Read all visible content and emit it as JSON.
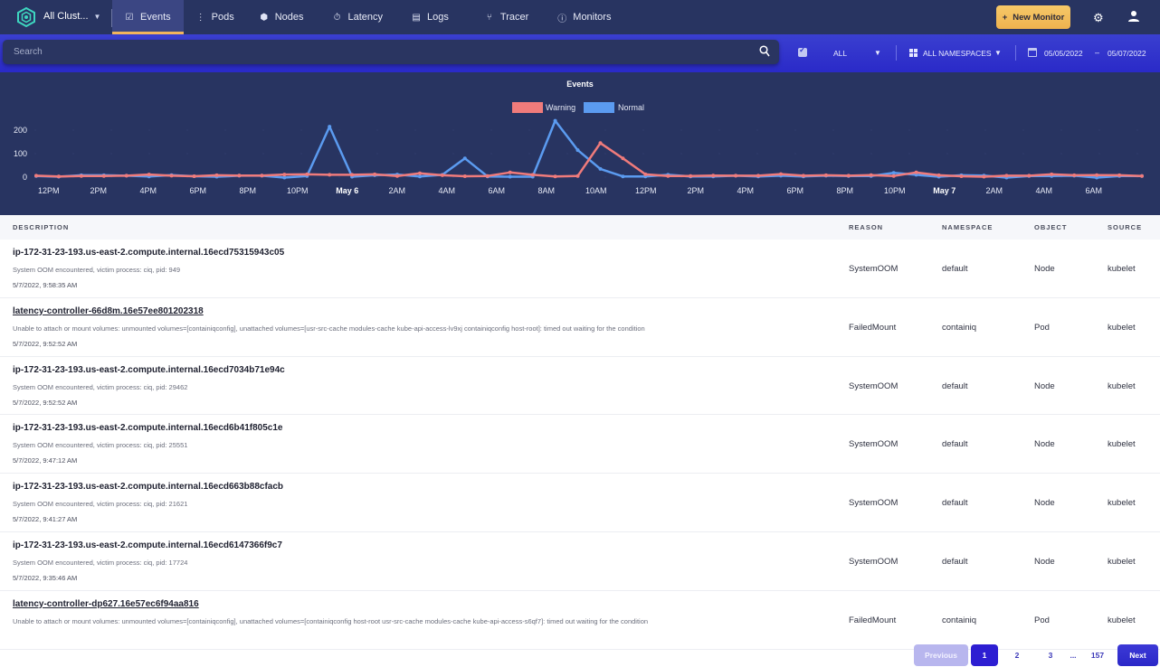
{
  "topbar": {
    "cluster_label": "All Clust...",
    "nav": [
      {
        "label": "Events",
        "icon": "check-square-icon",
        "active": true
      },
      {
        "label": "Pods",
        "icon": "dots-vertical-icon",
        "active": false
      },
      {
        "label": "Nodes",
        "icon": "hexagon-icon",
        "active": false
      },
      {
        "label": "Latency",
        "icon": "stopwatch-icon",
        "active": false
      },
      {
        "label": "Logs",
        "icon": "document-icon",
        "active": false
      },
      {
        "label": "Tracer",
        "icon": "branch-icon",
        "active": false
      },
      {
        "label": "Monitors",
        "icon": "info-circle-icon",
        "active": false
      }
    ],
    "new_monitor_label": "New Monitor",
    "new_monitor_plus": "+"
  },
  "filters": {
    "search_placeholder": "Search",
    "search_value": "",
    "type_value": "ALL",
    "namespace_value": "ALL NAMESPACES",
    "date_from": "05/05/2022",
    "date_sep": "–",
    "date_to": "05/07/2022"
  },
  "chart_data": {
    "type": "line",
    "title": "Events",
    "legend_position": "top-center",
    "xlabel": "",
    "ylabel": "",
    "ylim": [
      0,
      250
    ],
    "yticks": [
      "0",
      "100",
      "200"
    ],
    "x_tick_labels": [
      "12PM",
      "2PM",
      "4PM",
      "6PM",
      "8PM",
      "10PM",
      "May 6",
      "2AM",
      "4AM",
      "6AM",
      "8AM",
      "10AM",
      "12PM",
      "2PM",
      "4PM",
      "6PM",
      "8PM",
      "10PM",
      "May 7",
      "2AM",
      "4AM",
      "6AM"
    ],
    "x_tick_bold": [
      "May 6",
      "May 7"
    ],
    "x_start_hours": -0.5,
    "x_step_hours": 1,
    "series": [
      {
        "name": "Warning",
        "color": "#f07b7b",
        "values": [
          6,
          3,
          5,
          5,
          6,
          11,
          6,
          4,
          8,
          7,
          7,
          11,
          12,
          10,
          10,
          12,
          5,
          16,
          8,
          4,
          5,
          20,
          10,
          3,
          5,
          145,
          80,
          12,
          5,
          5,
          7,
          6,
          6,
          13,
          6,
          8,
          6,
          9,
          5,
          20,
          8,
          4,
          2,
          6,
          6,
          12,
          8,
          9,
          8,
          5
        ]
      },
      {
        "name": "Normal",
        "color": "#5b9bf0",
        "values": [
          5,
          2,
          8,
          8,
          6,
          3,
          9,
          4,
          2,
          6,
          6,
          -2,
          5,
          215,
          2,
          8,
          11,
          3,
          10,
          80,
          3,
          2,
          2,
          240,
          115,
          35,
          3,
          3,
          10,
          3,
          3,
          6,
          3,
          6,
          3,
          6,
          5,
          5,
          18,
          10,
          2,
          8,
          7,
          -2,
          5,
          5,
          6,
          -2,
          5,
          5
        ]
      }
    ]
  },
  "table": {
    "headers": {
      "description": "DESCRIPTION",
      "reason": "REASON",
      "namespace": "NAMESPACE",
      "object": "OBJECT",
      "source": "SOURCE"
    },
    "rows": [
      {
        "name": "ip-172-31-23-193.us-east-2.compute.internal.16ecd75315943c05",
        "link": false,
        "message": "System OOM encountered, victim process: ciq, pid: 949",
        "time": "5/7/2022, 9:58:35 AM",
        "reason": "SystemOOM",
        "namespace": "default",
        "object": "Node",
        "source": "kubelet"
      },
      {
        "name": "latency-controller-66d8m.16e57ee801202318",
        "link": true,
        "message": "Unable to attach or mount volumes: unmounted volumes=[containiqconfig], unattached volumes=[usr-src-cache modules-cache kube-api-access-lv9xj containiqconfig host-root]: timed out waiting for the condition",
        "time": "5/7/2022, 9:52:52 AM",
        "reason": "FailedMount",
        "namespace": "containiq",
        "object": "Pod",
        "source": "kubelet"
      },
      {
        "name": "ip-172-31-23-193.us-east-2.compute.internal.16ecd7034b71e94c",
        "link": false,
        "message": "System OOM encountered, victim process: ciq, pid: 29462",
        "time": "5/7/2022, 9:52:52 AM",
        "reason": "SystemOOM",
        "namespace": "default",
        "object": "Node",
        "source": "kubelet"
      },
      {
        "name": "ip-172-31-23-193.us-east-2.compute.internal.16ecd6b41f805c1e",
        "link": false,
        "message": "System OOM encountered, victim process: ciq, pid: 25551",
        "time": "5/7/2022, 9:47:12 AM",
        "reason": "SystemOOM",
        "namespace": "default",
        "object": "Node",
        "source": "kubelet"
      },
      {
        "name": "ip-172-31-23-193.us-east-2.compute.internal.16ecd663b88cfacb",
        "link": false,
        "message": "System OOM encountered, victim process: ciq, pid: 21621",
        "time": "5/7/2022, 9:41:27 AM",
        "reason": "SystemOOM",
        "namespace": "default",
        "object": "Node",
        "source": "kubelet"
      },
      {
        "name": "ip-172-31-23-193.us-east-2.compute.internal.16ecd6147366f9c7",
        "link": false,
        "message": "System OOM encountered, victim process: ciq, pid: 17724",
        "time": "5/7/2022, 9:35:46 AM",
        "reason": "SystemOOM",
        "namespace": "default",
        "object": "Node",
        "source": "kubelet"
      },
      {
        "name": "latency-controller-dp627.16e57ec6f94aa816",
        "link": true,
        "message": "Unable to attach or mount volumes: unmounted volumes=[containiqconfig], unattached volumes=[containiqconfig host-root usr-src-cache modules-cache kube-api-access-s6qf7]: timed out waiting for the condition",
        "time": "",
        "reason": "FailedMount",
        "namespace": "containiq",
        "object": "Pod",
        "source": "kubelet"
      }
    ]
  },
  "pagination": {
    "previous_label": "Previous",
    "pages": [
      "1",
      "2",
      "3"
    ],
    "ellipsis": "...",
    "last_page": "157",
    "current_page": "1",
    "next_label": "Next"
  },
  "colors": {
    "topbar_bg": "#283461",
    "filterbar_bg": "#3a3fd0",
    "accent_orange": "#f2b45c",
    "warning": "#f07b7b",
    "normal": "#5b9bf0",
    "primary_button": "#2d1ed2"
  }
}
